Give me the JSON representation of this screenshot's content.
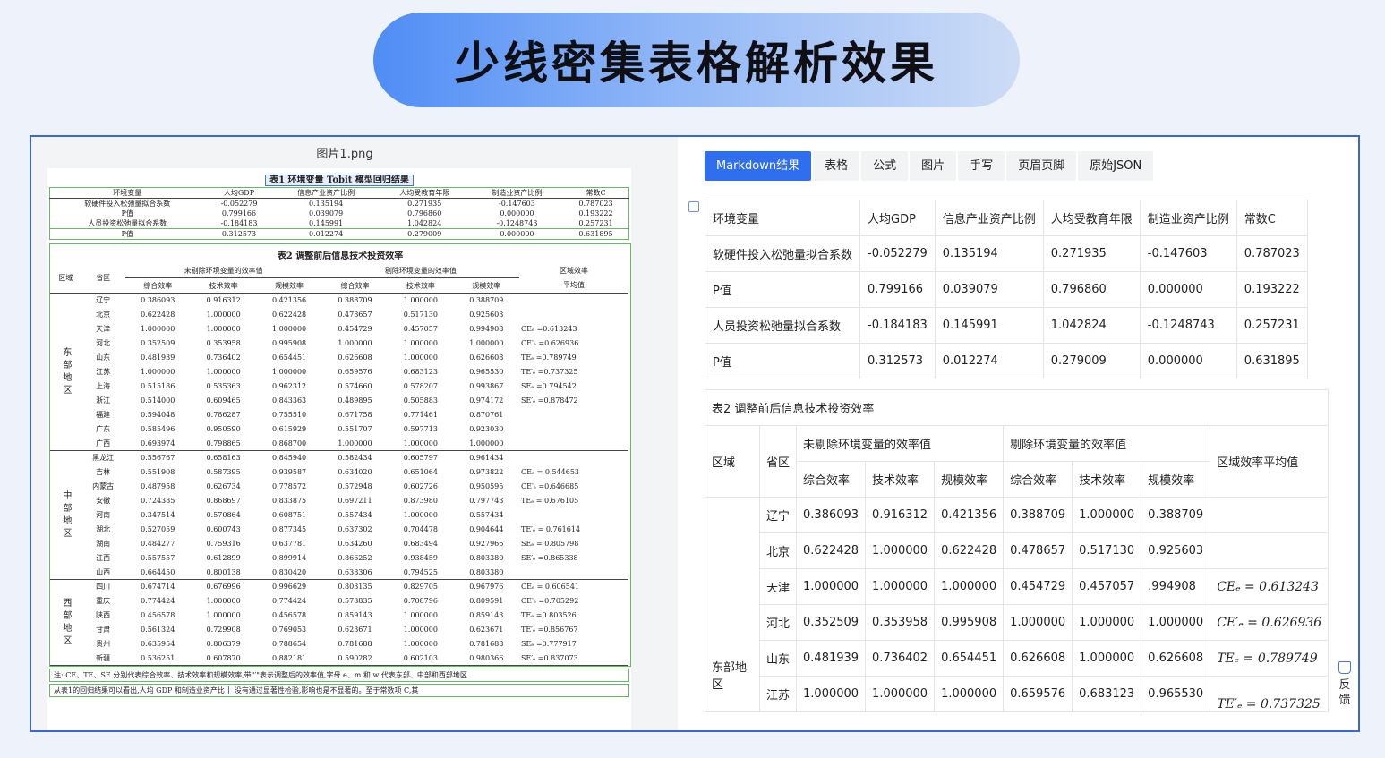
{
  "banner": {
    "title": "少线密集表格解析效果"
  },
  "doc": {
    "filename": "图片1.png",
    "table1": {
      "title": "表1   环境变量 Tobit 模型回归结果",
      "headers": [
        "环境变量",
        "人均GDP",
        "信息产业资产比例",
        "人均受教育年限",
        "制造业资产比例",
        "常数C"
      ],
      "rows": [
        [
          "软硬件投入松弛量拟合系数",
          "-0.052279",
          "0.135194",
          "0.271935",
          "-0.147603",
          "0.787023"
        ],
        [
          "P值",
          "0.799166",
          "0.039079",
          "0.796860",
          "0.000000",
          "0.193222"
        ],
        [
          "人员投资松弛量拟合系数",
          "-0.184183",
          "0.145991",
          "1.042824",
          "-0.1248743",
          "0.257231"
        ],
        [
          "P值",
          "0.312573",
          "0.012274",
          "0.279009",
          "0.000000",
          "0.631895"
        ]
      ]
    },
    "table2": {
      "title": "表2   调整前后信息技术投资效率",
      "h1": [
        "区域",
        "省区",
        "未剔除环境变量的效率值",
        "剔除环境变量的效率值",
        "区域效率"
      ],
      "h2": [
        "综合效率",
        "技术效率",
        "规模效率",
        "综合效率",
        "技术效率",
        "规模效率",
        "平均值"
      ],
      "regions": [
        {
          "name": "东部地区",
          "rows": [
            [
              "辽宁",
              "0.386093",
              "0.916312",
              "0.421356",
              "0.388709",
              "1.000000",
              "0.388709",
              ""
            ],
            [
              "北京",
              "0.622428",
              "1.000000",
              "0.622428",
              "0.478657",
              "0.517130",
              "0.925603",
              ""
            ],
            [
              "天津",
              "1.000000",
              "1.000000",
              "1.000000",
              "0.454729",
              "0.457057",
              "0.994908",
              "CEₑ =0.613243"
            ],
            [
              "河北",
              "0.352509",
              "0.353958",
              "0.995908",
              "1.000000",
              "1.000000",
              "1.000000",
              "CE′ₑ =0.626936"
            ],
            [
              "山东",
              "0.481939",
              "0.736402",
              "0.654451",
              "0.626608",
              "1.000000",
              "0.626608",
              "TEₑ =0.789749"
            ],
            [
              "江苏",
              "1.000000",
              "1.000000",
              "1.000000",
              "0.659576",
              "0.683123",
              "0.965530",
              "TE′ₑ =0.737325"
            ],
            [
              "上海",
              "0.515186",
              "0.535363",
              "0.962312",
              "0.574660",
              "0.578207",
              "0.993867",
              "SEₑ =0.794542"
            ],
            [
              "浙江",
              "0.514000",
              "0.609465",
              "0.843363",
              "0.489895",
              "0.505883",
              "0.974172",
              "SE′ₑ =0.878472"
            ],
            [
              "福建",
              "0.594048",
              "0.786287",
              "0.755510",
              "0.671758",
              "0.771461",
              "0.870761",
              ""
            ],
            [
              "广东",
              "0.585496",
              "0.950590",
              "0.615929",
              "0.551707",
              "0.597713",
              "0.923030",
              ""
            ],
            [
              "广西",
              "0.693974",
              "0.798865",
              "0.868700",
              "1.000000",
              "1.000000",
              "1.000000",
              ""
            ]
          ]
        },
        {
          "name": "中部地区",
          "rows": [
            [
              "黑龙江",
              "0.556767",
              "0.658163",
              "0.845940",
              "0.582434",
              "0.605797",
              "0.961434",
              ""
            ],
            [
              "吉林",
              "0.551908",
              "0.587395",
              "0.939587",
              "0.634020",
              "0.651064",
              "0.973822",
              "CEₑ = 0.544653"
            ],
            [
              "内蒙古",
              "0.487958",
              "0.626734",
              "0.778572",
              "0.572948",
              "0.602726",
              "0.950595",
              "CE′ₑ =0.646685"
            ],
            [
              "安徽",
              "0.724385",
              "0.868697",
              "0.833875",
              "0.697211",
              "0.873980",
              "0.797743",
              "TEₑ = 0.676105"
            ],
            [
              "河南",
              "0.347514",
              "0.570864",
              "0.608751",
              "0.557434",
              "1.000000",
              "0.557434",
              ""
            ],
            [
              "湖北",
              "0.527059",
              "0.600743",
              "0.877345",
              "0.637302",
              "0.704478",
              "0.904644",
              "TE′ₑ = 0.761614"
            ],
            [
              "湖南",
              "0.484277",
              "0.759316",
              "0.637781",
              "0.634260",
              "0.683494",
              "0.927966",
              "SEₑ = 0.805798"
            ],
            [
              "江西",
              "0.557557",
              "0.612899",
              "0.899914",
              "0.866252",
              "0.938459",
              "0.803380",
              "SE′ₑ =0.865338"
            ],
            [
              "山西",
              "0.664450",
              "0.800138",
              "0.830420",
              "0.638306",
              "0.794525",
              "0.803380",
              ""
            ]
          ]
        },
        {
          "name": "西部地区",
          "rows": [
            [
              "四川",
              "0.674714",
              "0.676996",
              "0.996629",
              "0.803135",
              "0.829705",
              "0.967976",
              "CEₑ = 0.606541"
            ],
            [
              "重庆",
              "0.774424",
              "1.000000",
              "0.774424",
              "0.573835",
              "0.708796",
              "0.809591",
              "CE′ₑ =0.705292"
            ],
            [
              "陕西",
              "0.456578",
              "1.000000",
              "0.456578",
              "0.859143",
              "1.000000",
              "0.859143",
              "TEₑ =0.803526"
            ],
            [
              "甘肃",
              "0.561324",
              "0.729908",
              "0.769053",
              "0.623671",
              "1.000000",
              "0.623671",
              "TE′ₑ =0.856767"
            ],
            [
              "贵州",
              "0.635954",
              "0.806379",
              "0.788654",
              "0.781688",
              "1.000000",
              "0.781688",
              "SEₑ =0.777917"
            ],
            [
              "新疆",
              "0.536251",
              "0.607870",
              "0.882181",
              "0.590282",
              "0.602103",
              "0.980366",
              "SE′ₑ =0.837073"
            ]
          ]
        }
      ]
    },
    "note": "注: CE、TE、SE 分别代表综合效率、技术效率和规模效率,带\"′\"表示调整后的效率值,字母 e、m 和 w 代表东部、中部和西部地区",
    "text_left": "从表1的回归结果可以看出,人均 GDP 和制造业资产比",
    "text_right": "没有通过显著性检验,影响也是不显著的。至于常数项 C,其"
  },
  "result": {
    "tabs": [
      "Markdown结果",
      "表格",
      "公式",
      "图片",
      "手写",
      "页眉页脚",
      "原始JSON"
    ],
    "table1": {
      "headers": [
        "环境变量",
        "人均GDP",
        "信息产业资产比例",
        "人均受教育年限",
        "制造业资产比例",
        "常数C"
      ],
      "rows": [
        [
          "软硬件投入松弛量拟合系数",
          "-0.052279",
          "0.135194",
          "0.271935",
          "-0.147603",
          "0.787023"
        ],
        [
          "P值",
          "0.799166",
          "0.039079",
          "0.796860",
          "0.000000",
          "0.193222"
        ],
        [
          "人员投资松弛量拟合系数",
          "-0.184183",
          "0.145991",
          "1.042824",
          "-0.1248743",
          "0.257231"
        ],
        [
          "P值",
          "0.312573",
          "0.012274",
          "0.279009",
          "0.000000",
          "0.631895"
        ]
      ]
    },
    "table2": {
      "title": "表2 调整前后信息技术投资效率",
      "h1": [
        "区域",
        "省区",
        "未剔除环境变量的效率值",
        "剔除环境变量的效率值",
        "区域效率平均值"
      ],
      "h2": [
        "综合效率",
        "技术效率",
        "规模效率",
        "综合效率",
        "技术效率",
        "规模效率"
      ],
      "region": "东部地区",
      "rows": [
        [
          "辽宁",
          "0.386093",
          "0.916312",
          "0.421356",
          "0.388709",
          "1.000000",
          "0.388709",
          ""
        ],
        [
          "北京",
          "0.622428",
          "1.000000",
          "0.622428",
          "0.478657",
          "0.517130",
          "0.925603",
          ""
        ],
        [
          "天津",
          "1.000000",
          "1.000000",
          "1.000000",
          "0.454729",
          "0.457057",
          ".994908",
          "CEₑ = 0.613243"
        ],
        [
          "河北",
          "0.352509",
          "0.353958",
          "0.995908",
          "1.000000",
          "1.000000",
          "1.000000",
          "CE′ₑ = 0.626936"
        ],
        [
          "山东",
          "0.481939",
          "0.736402",
          "0.654451",
          "0.626608",
          "1.000000",
          "0.626608",
          "TEₑ = 0.789749"
        ],
        [
          "江苏",
          "1.000000",
          "1.000000",
          "1.000000",
          "0.659576",
          "0.683123",
          "0.965530",
          "TE′ₑ = 0.737325"
        ]
      ]
    },
    "feedback_label": "反馈"
  }
}
